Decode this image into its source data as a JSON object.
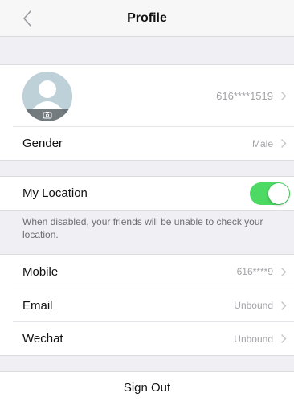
{
  "header": {
    "title": "Profile",
    "back_icon": "chevron-left-icon"
  },
  "profile": {
    "account_id": "616****1519"
  },
  "gender": {
    "label": "Gender",
    "value": "Male"
  },
  "location": {
    "label": "My Location",
    "enabled": true,
    "hint": "When disabled, your friends will be unable to check your location."
  },
  "bindings": [
    {
      "label": "Mobile",
      "value": "616****9"
    },
    {
      "label": "Email",
      "value": "Unbound"
    },
    {
      "label": "Wechat",
      "value": "Unbound"
    }
  ],
  "sign_out_label": "Sign Out",
  "colors": {
    "toggle_on": "#4cd964",
    "background": "#efeff4",
    "secondary_text": "#a3a3a8"
  }
}
